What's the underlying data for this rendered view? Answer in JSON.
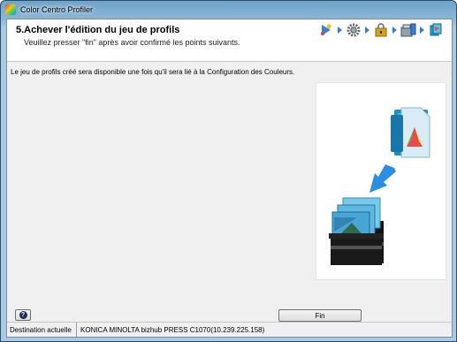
{
  "window": {
    "title": "Color Centro Profiler"
  },
  "header": {
    "title": "5.Achever l'édition du jeu de profils",
    "subtitle": "Veuillez presser \"fin\" après avoir confirmé les points suivants."
  },
  "wizard_steps": [
    "step-start-icon",
    "step-settings-icon",
    "step-lock-icon",
    "step-device-icon",
    "step-finish-icon"
  ],
  "body": {
    "info": "Le jeu de profils créé sera disponible une fois qu'il sera lié à la Configuration des Couleurs."
  },
  "buttons": {
    "help": "?",
    "finish": "Fin"
  },
  "status": {
    "label": "Destination actuelle",
    "value": "KONICA MINOLTA bizhub PRESS C1070(10.239.225.158)"
  },
  "colors": {
    "accent": "#2e7fd8",
    "frame": "#a9c9e2"
  }
}
